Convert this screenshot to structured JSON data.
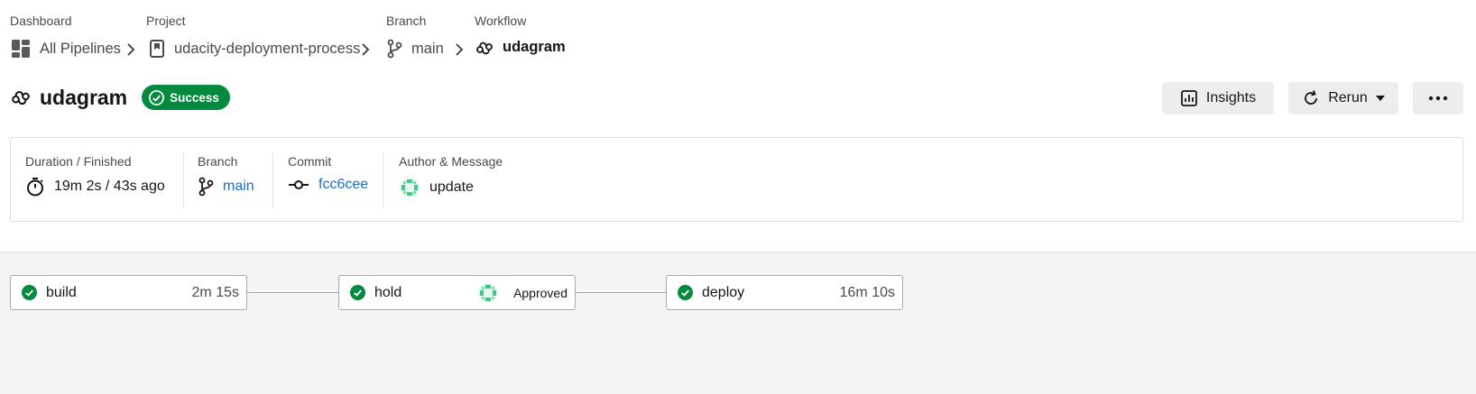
{
  "breadcrumb": {
    "dashboard": {
      "label": "Dashboard",
      "value": "All Pipelines"
    },
    "project": {
      "label": "Project",
      "value": "udacity-deployment-process"
    },
    "branch": {
      "label": "Branch",
      "value": "main"
    },
    "workflow": {
      "label": "Workflow",
      "value": "udagram"
    }
  },
  "header": {
    "title": "udagram",
    "status": "Success",
    "insights_label": "Insights",
    "rerun_label": "Rerun",
    "more_icon": "ellipsis-icon"
  },
  "summary": {
    "duration": {
      "label": "Duration / Finished",
      "value": "19m 2s / 43s ago"
    },
    "branch": {
      "label": "Branch",
      "value": "main"
    },
    "commit": {
      "label": "Commit",
      "value": "fcc6cee"
    },
    "author": {
      "label": "Author & Message",
      "value": "update"
    }
  },
  "jobs": [
    {
      "name": "build",
      "duration": "2m 15s",
      "status": "success"
    },
    {
      "name": "hold",
      "approval": "Approved",
      "status": "success"
    },
    {
      "name": "deploy",
      "duration": "16m 10s",
      "status": "success"
    }
  ],
  "colors": {
    "success": "#048a3e",
    "link": "#1a6ecb",
    "button_bg": "#ededed",
    "avatar": "#3ec986"
  }
}
